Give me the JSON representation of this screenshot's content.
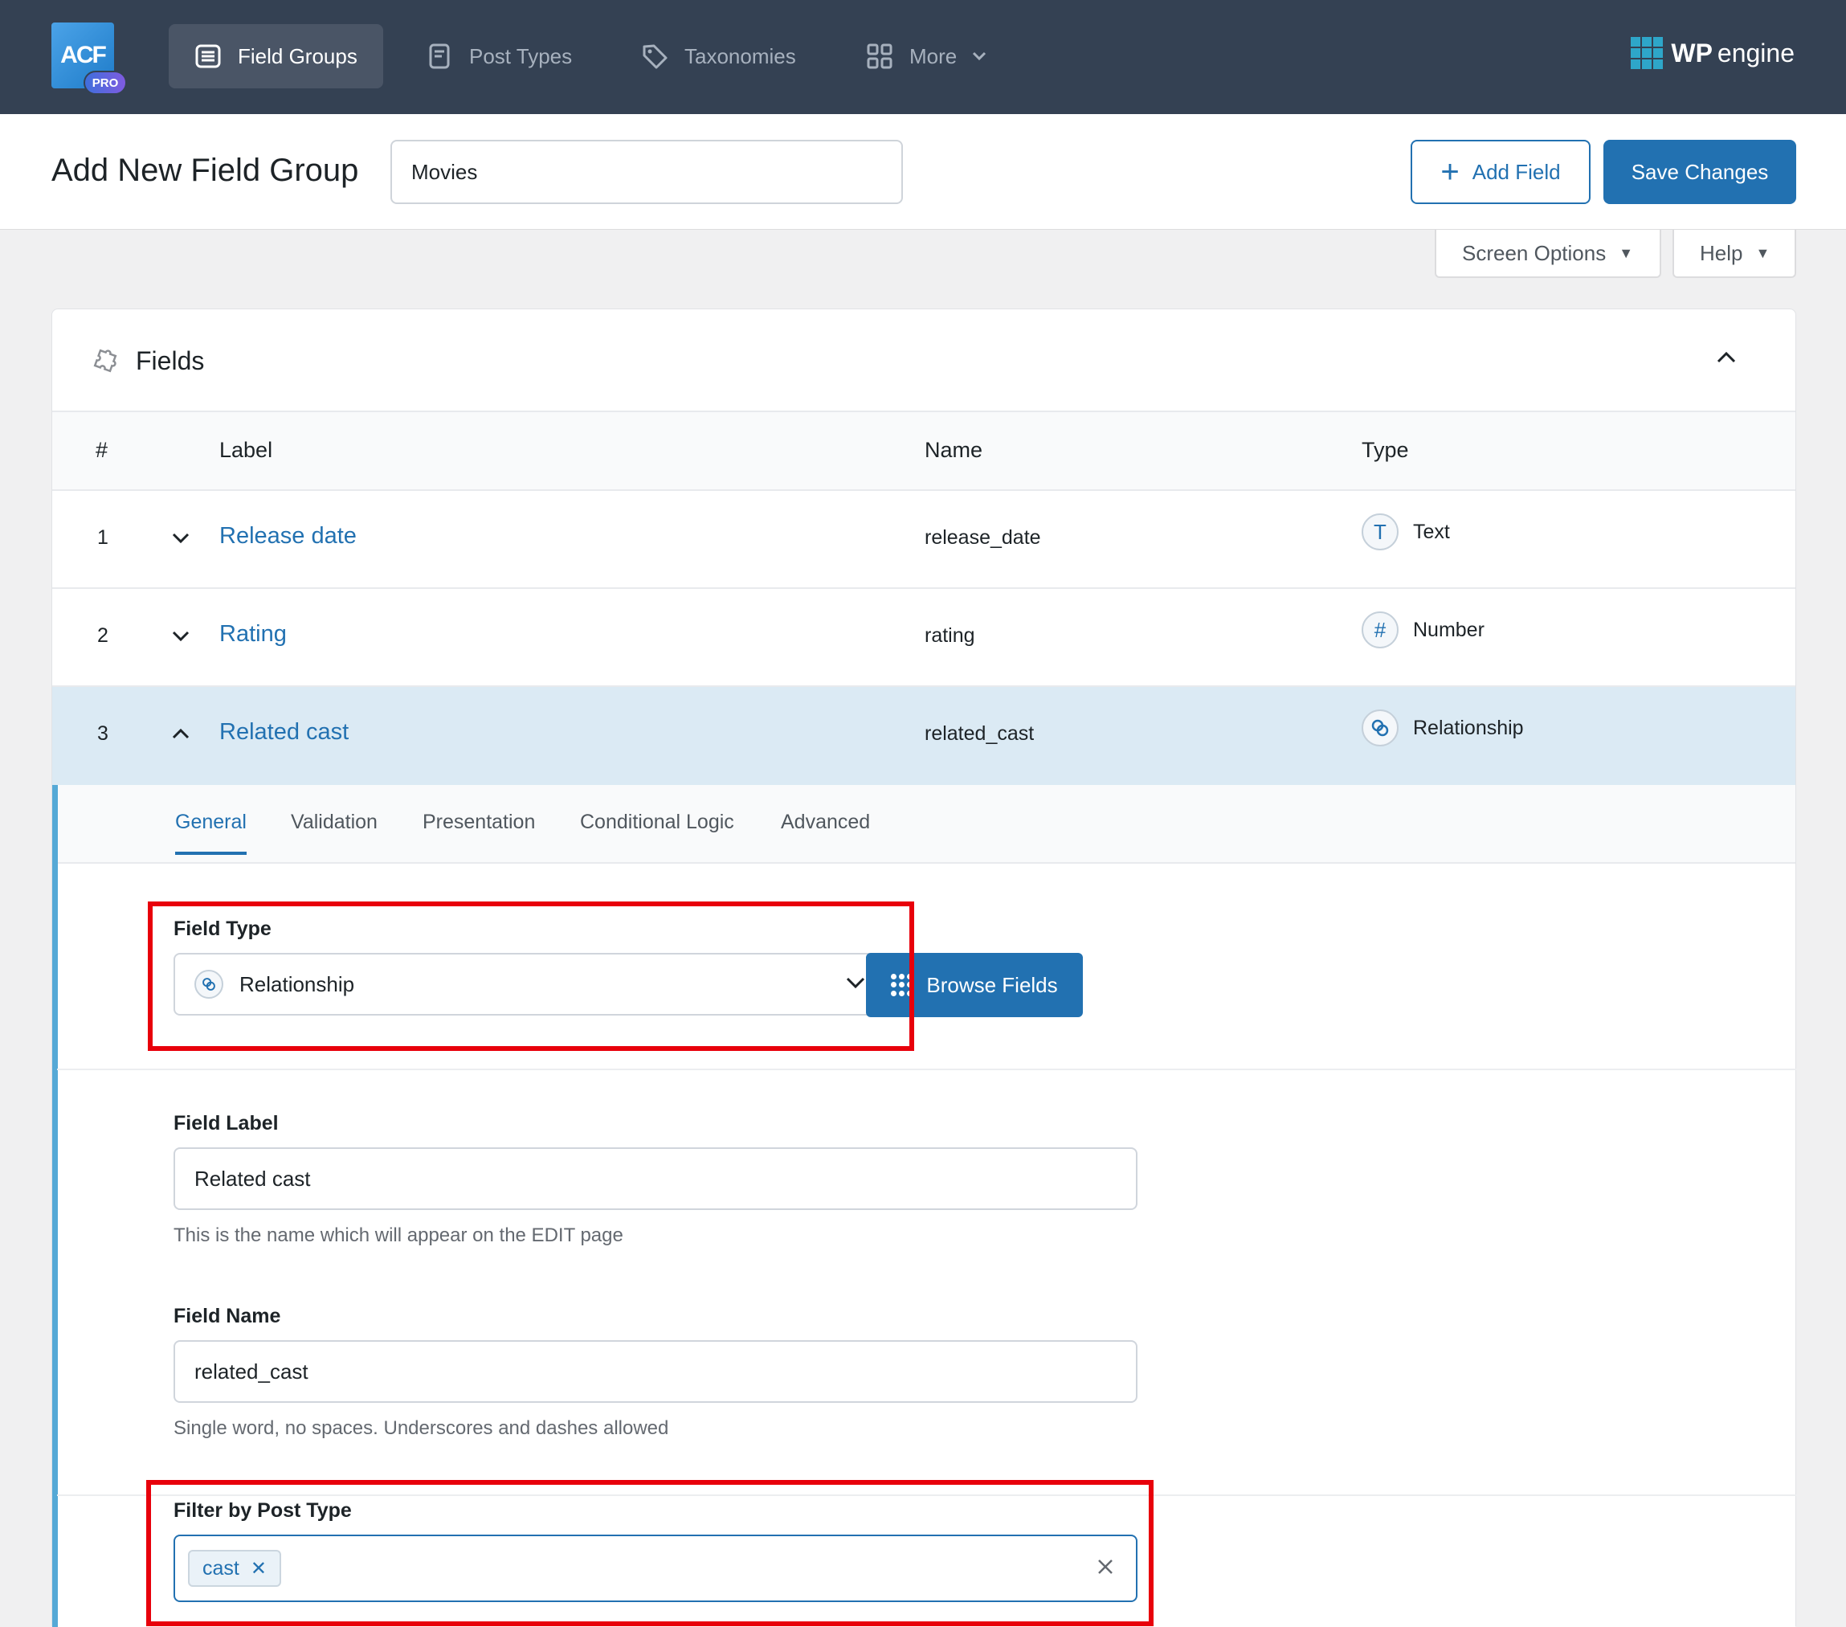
{
  "brand": {
    "logo_text": "ACF",
    "badge": "PRO",
    "partner_bold": "WP",
    "partner_rest": "engine"
  },
  "nav": {
    "items": [
      {
        "label": "Field Groups",
        "icon": "list-icon",
        "active": true
      },
      {
        "label": "Post Types",
        "icon": "document-icon",
        "active": false
      },
      {
        "label": "Taxonomies",
        "icon": "tag-icon",
        "active": false
      },
      {
        "label": "More",
        "icon": "grid-icon",
        "active": false
      }
    ]
  },
  "header": {
    "title": "Add New Field Group",
    "group_name": "Movies",
    "add_field_label": "Add Field",
    "save_label": "Save Changes",
    "screen_options_label": "Screen Options",
    "help_label": "Help"
  },
  "fields_panel": {
    "title": "Fields",
    "columns": [
      "#",
      "Label",
      "Name",
      "Type"
    ],
    "rows": [
      {
        "num": "1",
        "label": "Release date",
        "name": "release_date",
        "type": "Text",
        "type_glyph": "T"
      },
      {
        "num": "2",
        "label": "Rating",
        "name": "rating",
        "type": "Number",
        "type_glyph": "#"
      },
      {
        "num": "3",
        "label": "Related cast",
        "name": "related_cast",
        "type": "Relationship",
        "type_glyph": "⊘"
      }
    ]
  },
  "settings": {
    "tabs": [
      "General",
      "Validation",
      "Presentation",
      "Conditional Logic",
      "Advanced"
    ],
    "active_tab": "General",
    "field_type": {
      "label": "Field Type",
      "value": "Relationship"
    },
    "browse_label": "Browse Fields",
    "field_label": {
      "label": "Field Label",
      "value": "Related cast",
      "help": "This is the name which will appear on the EDIT page"
    },
    "field_name": {
      "label": "Field Name",
      "value": "related_cast",
      "help": "Single word, no spaces. Underscores and dashes allowed"
    },
    "filter_post_type": {
      "label": "Filter by Post Type",
      "tags": [
        "cast"
      ]
    }
  },
  "colors": {
    "nav_bg": "#344153",
    "accent": "#2271b1",
    "highlight_row": "#dbeaf4",
    "annotation_red": "#e8000b"
  }
}
